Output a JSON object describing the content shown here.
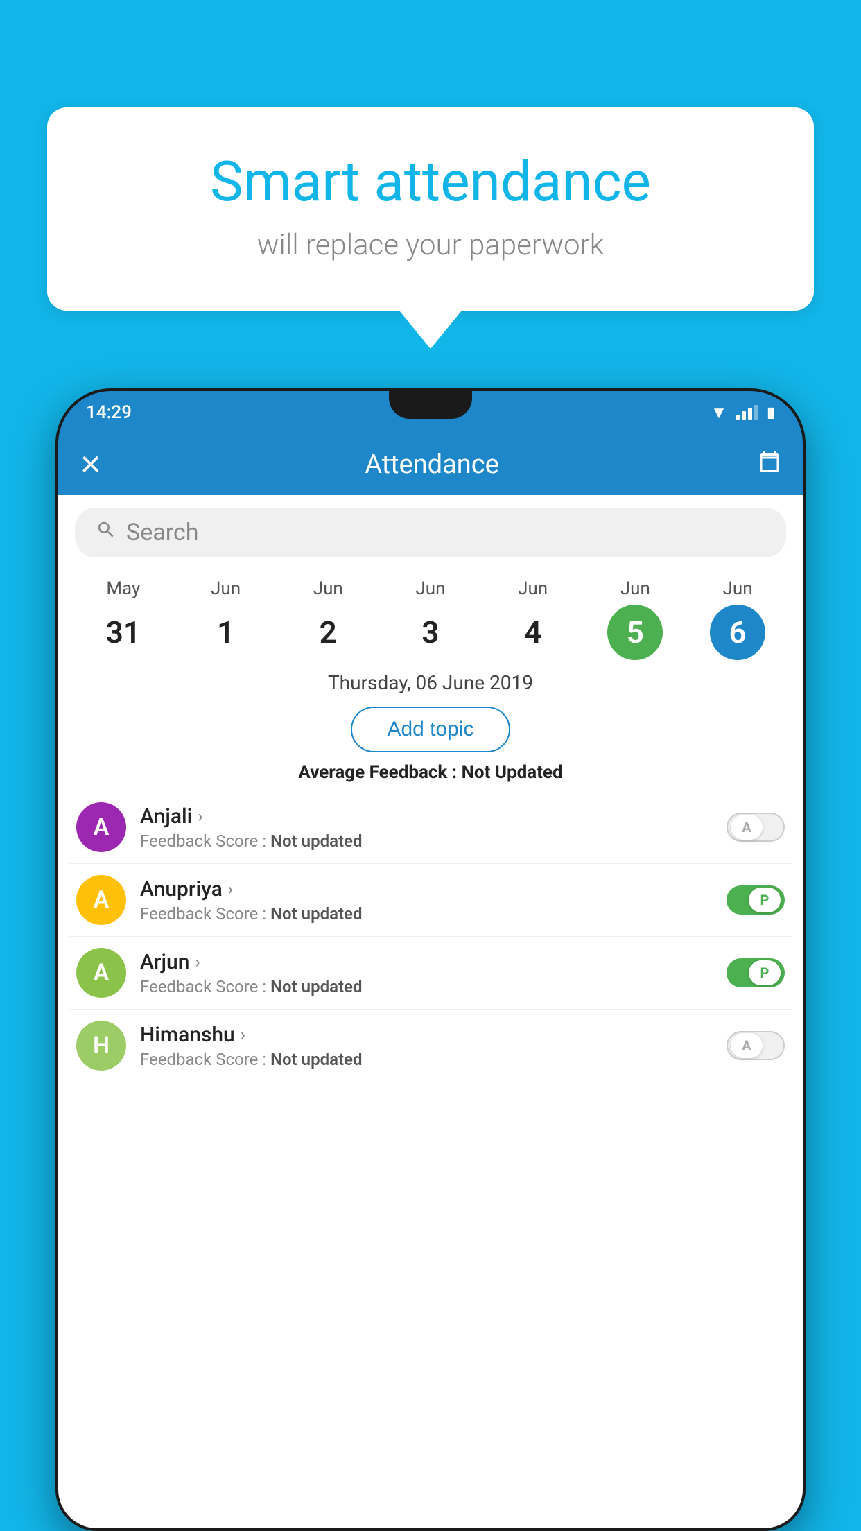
{
  "background": {
    "color": "#12b5e8"
  },
  "speech_bubble": {
    "title": "Smart attendance",
    "subtitle": "will replace your paperwork"
  },
  "status_bar": {
    "time": "14:29",
    "wifi": "▼",
    "battery": "🔋"
  },
  "app_bar": {
    "title": "Attendance",
    "close_label": "✕",
    "calendar_icon": "📅"
  },
  "search": {
    "placeholder": "Search"
  },
  "calendar": {
    "days": [
      {
        "month": "May",
        "date": "31",
        "state": "normal"
      },
      {
        "month": "Jun",
        "date": "1",
        "state": "normal"
      },
      {
        "month": "Jun",
        "date": "2",
        "state": "normal"
      },
      {
        "month": "Jun",
        "date": "3",
        "state": "normal"
      },
      {
        "month": "Jun",
        "date": "4",
        "state": "normal"
      },
      {
        "month": "Jun",
        "date": "5",
        "state": "today"
      },
      {
        "month": "Jun",
        "date": "6",
        "state": "selected"
      }
    ]
  },
  "selected_date_label": "Thursday, 06 June 2019",
  "add_topic_label": "Add topic",
  "feedback_summary": {
    "label": "Average Feedback : ",
    "value": "Not Updated"
  },
  "students": [
    {
      "name": "Anjali",
      "initial": "A",
      "avatar_color": "avatar-purple",
      "feedback_label": "Feedback Score : ",
      "feedback_value": "Not updated",
      "toggle": "off",
      "toggle_letter": "A"
    },
    {
      "name": "Anupriya",
      "initial": "A",
      "avatar_color": "avatar-yellow",
      "feedback_label": "Feedback Score : ",
      "feedback_value": "Not updated",
      "toggle": "on",
      "toggle_letter": "P"
    },
    {
      "name": "Arjun",
      "initial": "A",
      "avatar_color": "avatar-light-green",
      "feedback_label": "Feedback Score : ",
      "feedback_value": "Not updated",
      "toggle": "on",
      "toggle_letter": "P"
    },
    {
      "name": "Himanshu",
      "initial": "H",
      "avatar_color": "avatar-light-green2",
      "feedback_label": "Feedback Score : ",
      "feedback_value": "Not updated",
      "toggle": "off",
      "toggle_letter": "A"
    }
  ]
}
